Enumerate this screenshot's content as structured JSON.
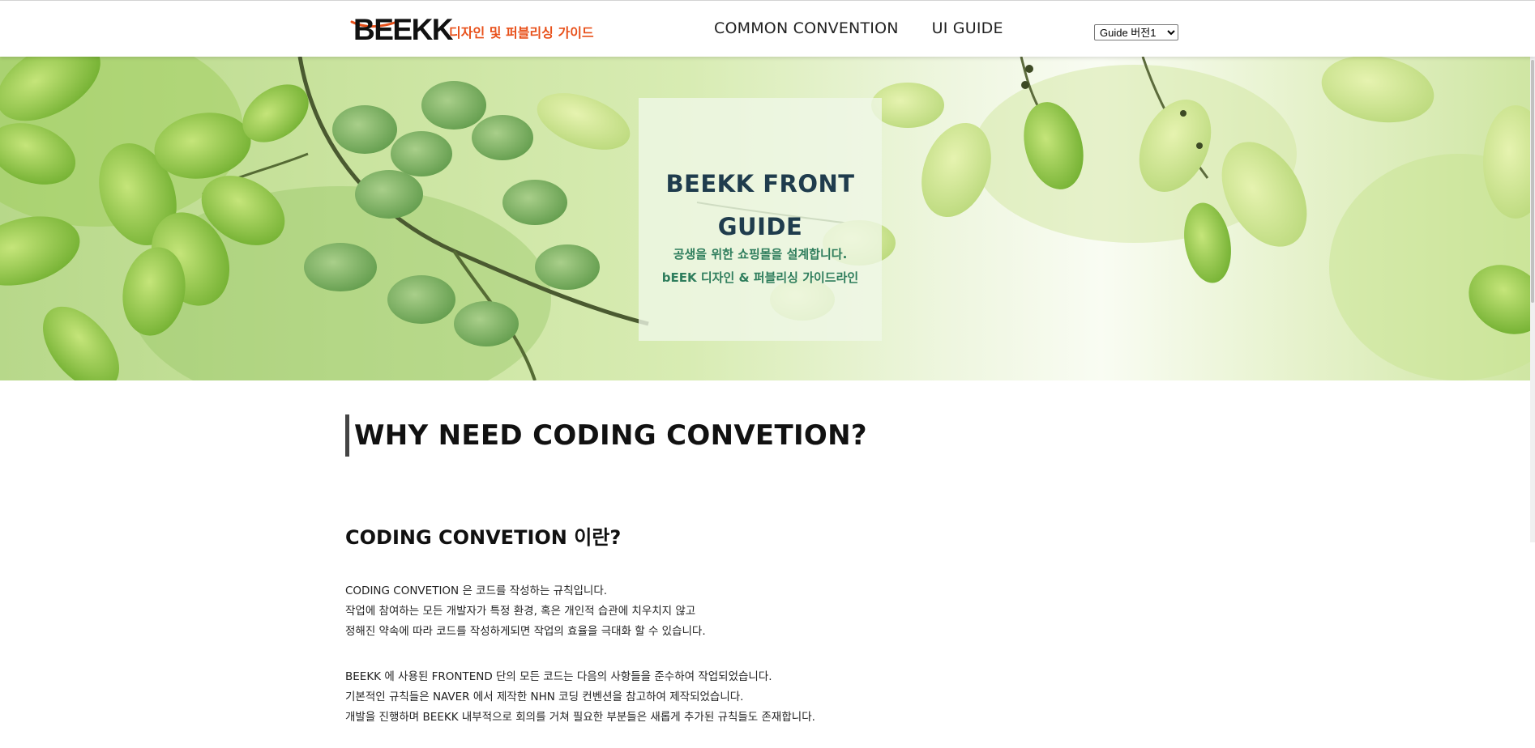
{
  "header": {
    "logo_text": "BEEKK",
    "logo_subtitle": "디자인 및 퍼블리싱 가이드",
    "nav": [
      {
        "label": "COMMON CONVENTION"
      },
      {
        "label": "UI GUIDE"
      }
    ],
    "version_select": {
      "selected": "Guide 버전1",
      "options": [
        "Guide 버전1"
      ]
    }
  },
  "hero": {
    "title_line1": "BEEKK FRONT",
    "title_line2": "GUIDE",
    "subtitle1": "공생을 위한 쇼핑몰을 설계합니다.",
    "subtitle2": "bEEK 디자인 & 퍼블리싱 가이드라인"
  },
  "main": {
    "section_title": "WHY NEED CODING CONVETION?",
    "sub_title": "CODING CONVETION 이란?",
    "paragraph1": [
      "CODING CONVETION 은 코드를 작성하는 규칙입니다.",
      "작업에 참여하는 모든 개발자가 특정 환경, 혹은 개인적 습관에 치우치지 않고",
      "정해진 약속에 따라 코드를 작성하게되면 작업의 효율을 극대화 할 수 있습니다."
    ],
    "paragraph2": [
      "BEEKK 에 사용된 FRONTEND 단의 모든 코드는 다음의 사항들을 준수하여 작업되었습니다.",
      "기본적인 규칙들은 NAVER 에서 제작한 NHN 코딩 컨벤션을 참고하여 제작되었습니다.",
      "개발을 진행하며 BEEKK 내부적으로 회의를 거쳐 필요한 부분들은 새롭게 추가된 규칙들도 존재합니다."
    ]
  },
  "colors": {
    "logo_accent": "#e8501a",
    "hero_title": "#1f3c4d",
    "hero_subtitle": "#2e7d5c"
  }
}
